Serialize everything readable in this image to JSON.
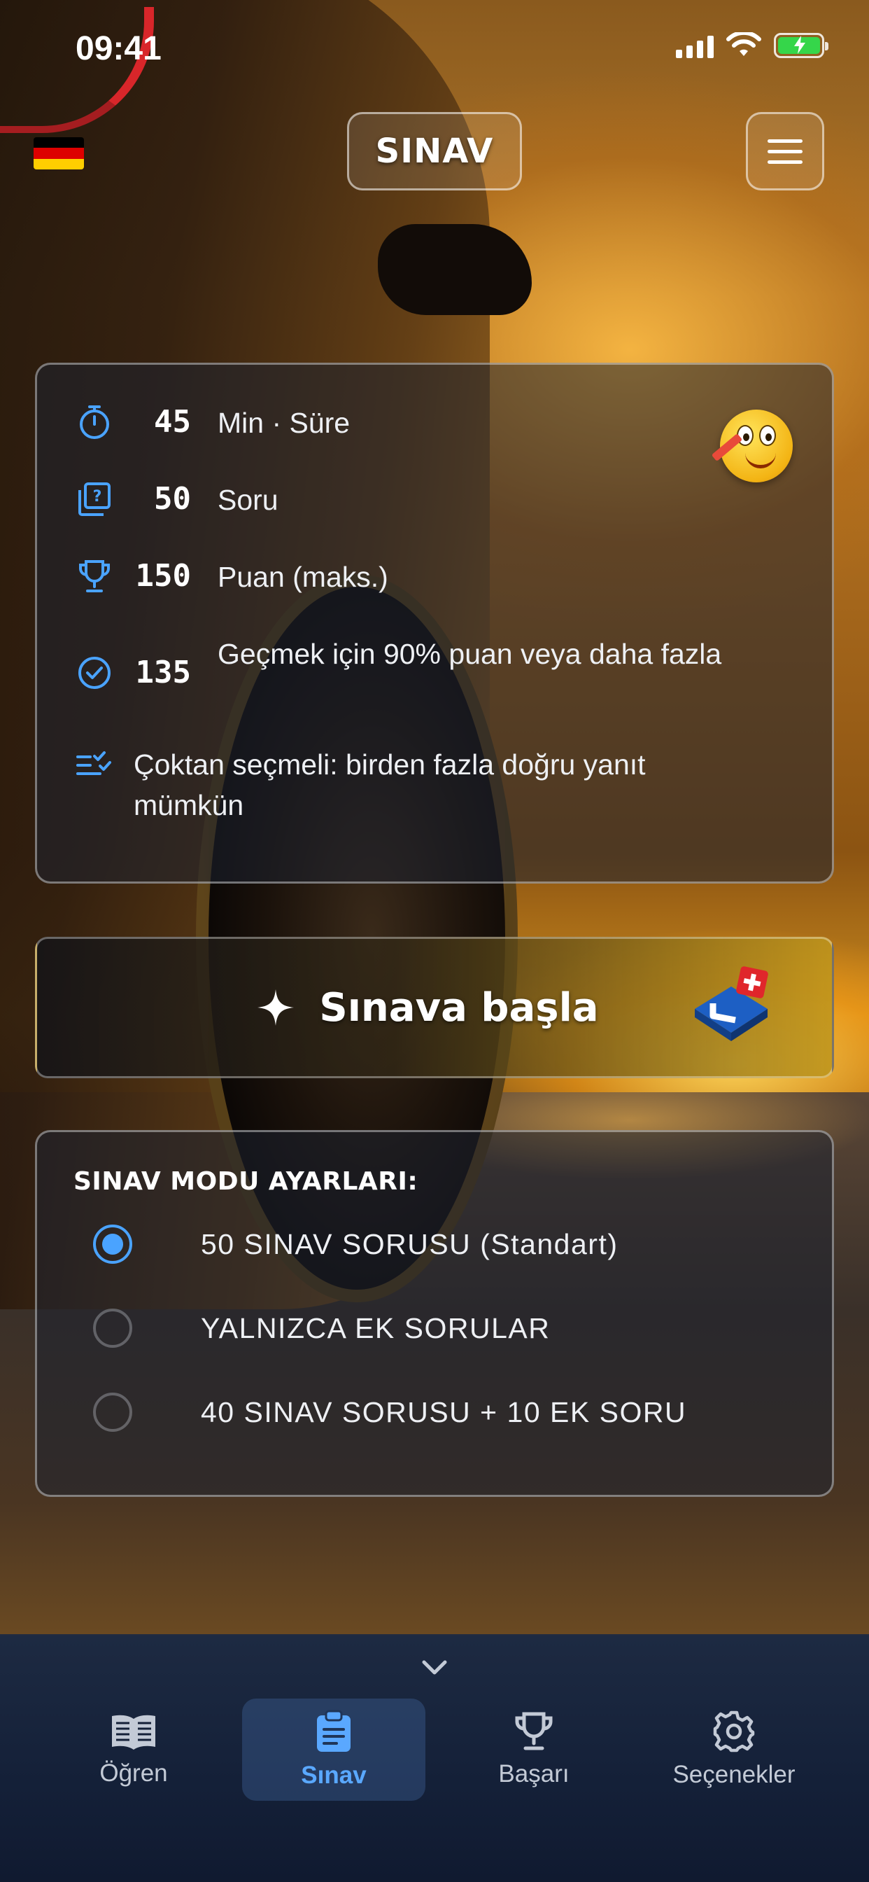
{
  "status_bar": {
    "time": "09:41",
    "icons": [
      "signal-icon",
      "wifi-icon",
      "battery-charging-icon"
    ],
    "battery_color": "#35d64a"
  },
  "header": {
    "title": "SINAV",
    "language_flag": "germany-flag",
    "menu_icon": "hamburger-menu-icon"
  },
  "info": {
    "rows": [
      {
        "icon": "stopwatch-icon",
        "value": "45",
        "text": "Min · Süre"
      },
      {
        "icon": "question-box-icon",
        "value": "50",
        "text": "Soru"
      },
      {
        "icon": "trophy-icon",
        "value": "150",
        "text": "Puan (maks.)"
      },
      {
        "icon": "check-circle-icon",
        "value": "135",
        "text": "Geçmek için 90% puan veya daha fazla"
      },
      {
        "icon": "checklist-icon",
        "value": "",
        "text": "Çoktan seçmeli: birden fazla doğru yanıt mümkün"
      }
    ],
    "mascot_icon": "thinking-emoji-icon"
  },
  "start": {
    "label": "Sınava başla",
    "icon": "sparkle-icon",
    "logo": "swiss-driving-logo"
  },
  "settings": {
    "title": "SINAV MODU AYARLARI:",
    "options": [
      {
        "label": "50 SINAV SORUSU (Standart)",
        "selected": true
      },
      {
        "label": "YALNIZCA EK SORULAR",
        "selected": false
      },
      {
        "label": "40 SINAV SORUSU + 10 EK SORU",
        "selected": false
      }
    ]
  },
  "bottom_nav": {
    "items": [
      {
        "label": "Öğren",
        "icon": "book-icon",
        "active": false
      },
      {
        "label": "Sınav",
        "icon": "clipboard-icon",
        "active": true
      },
      {
        "label": "Başarı",
        "icon": "trophy-icon",
        "active": false
      },
      {
        "label": "Seçenekler",
        "icon": "gear-icon",
        "active": false
      }
    ],
    "active_color": "#5aa8ff"
  },
  "colors": {
    "accent": "#4aa3ff",
    "flag": [
      "#000000",
      "#dd0000",
      "#ffce00"
    ]
  }
}
